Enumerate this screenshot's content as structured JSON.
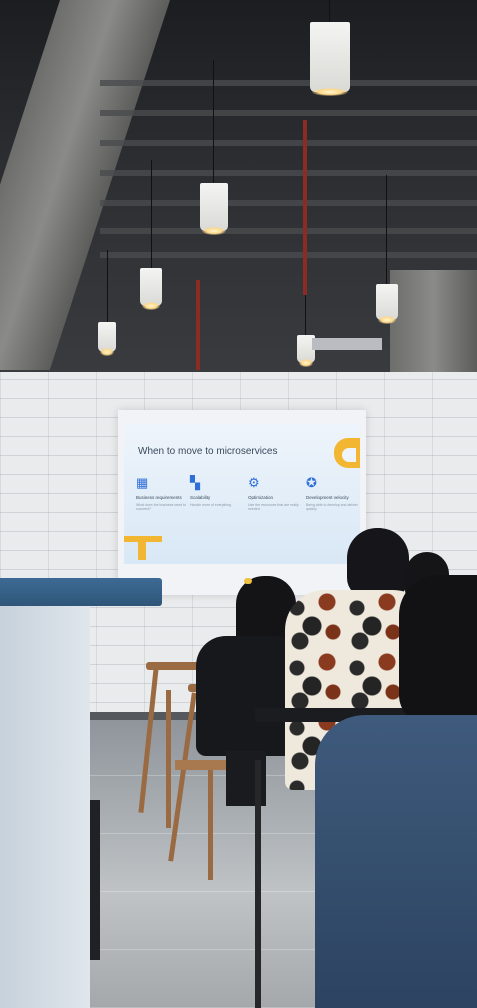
{
  "slide": {
    "title": "When to move to microservices",
    "items": [
      {
        "icon": "building-icon",
        "label": "Business requirements",
        "desc": "What does the business need to succeed?"
      },
      {
        "icon": "grid-icon",
        "label": "Scalability",
        "desc": "Handle more of everything"
      },
      {
        "icon": "gear-icon",
        "label": "Optimization",
        "desc": "Use the resources that are really needed"
      },
      {
        "icon": "star-icon",
        "label": "Development velocity",
        "desc": "Being able to develop and deliver quickly"
      }
    ],
    "accent_color": "#f2b632",
    "icon_color": "#2e6fd8"
  }
}
